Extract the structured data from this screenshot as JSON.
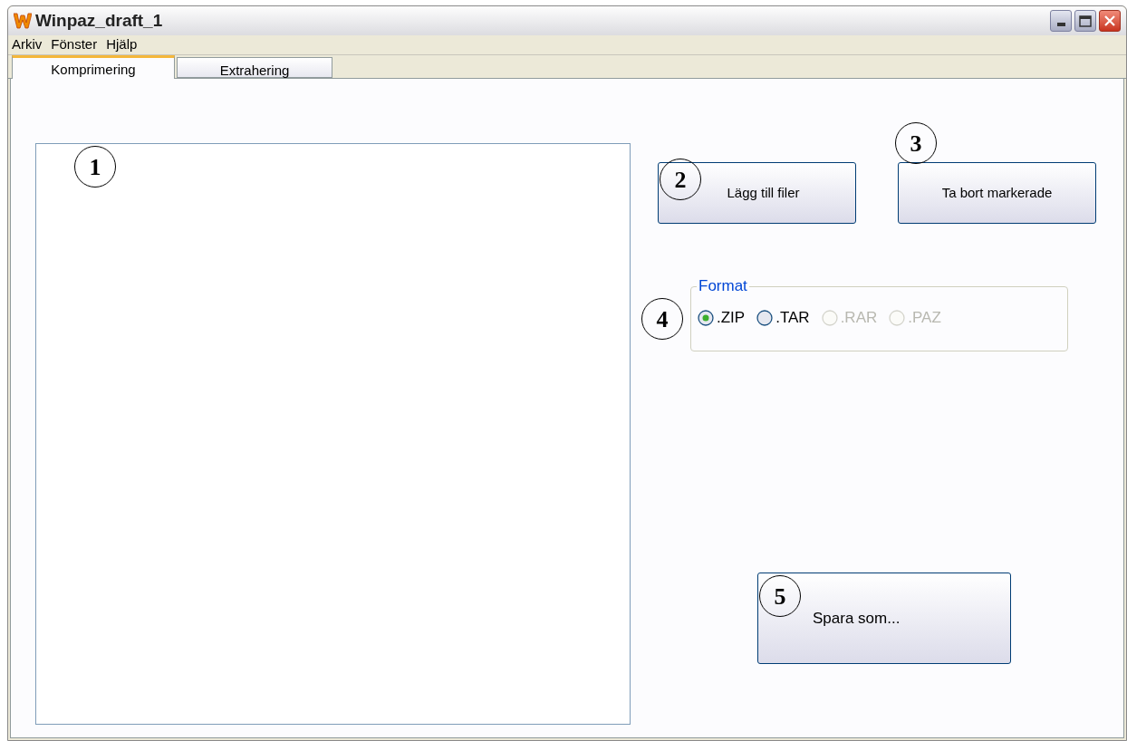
{
  "window": {
    "title": "Winpaz_draft_1"
  },
  "menu": [
    "Arkiv",
    "Fönster",
    "Hjälp"
  ],
  "tabs": [
    {
      "label": "Komprimering",
      "selected": true
    },
    {
      "label": "Extrahering",
      "selected": false
    }
  ],
  "buttons": {
    "add": "Lägg till filer",
    "remove": "Ta bort markerade",
    "save": "Spara som..."
  },
  "format": {
    "title": "Format",
    "options": [
      {
        "label": ".ZIP",
        "selected": true,
        "disabled": false
      },
      {
        "label": ".TAR",
        "selected": false,
        "disabled": false
      },
      {
        "label": ".RAR",
        "selected": false,
        "disabled": true
      },
      {
        "label": ".PAZ",
        "selected": false,
        "disabled": true
      }
    ]
  },
  "callouts": [
    "1",
    "2",
    "3",
    "4",
    "5"
  ]
}
